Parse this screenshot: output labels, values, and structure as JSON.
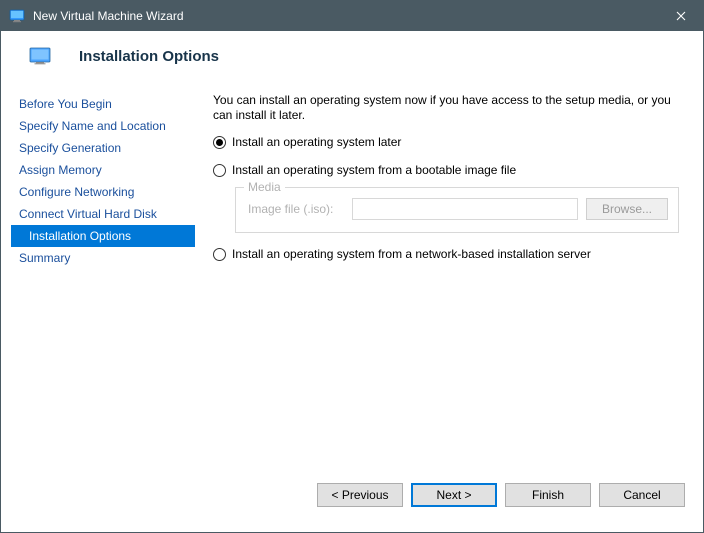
{
  "window": {
    "title": "New Virtual Machine Wizard"
  },
  "header": {
    "page_title": "Installation Options"
  },
  "sidebar": {
    "items": [
      {
        "label": "Before You Begin"
      },
      {
        "label": "Specify Name and Location"
      },
      {
        "label": "Specify Generation"
      },
      {
        "label": "Assign Memory"
      },
      {
        "label": "Configure Networking"
      },
      {
        "label": "Connect Virtual Hard Disk"
      },
      {
        "label": "Installation Options"
      },
      {
        "label": "Summary"
      }
    ],
    "selected_index": 6
  },
  "content": {
    "intro": "You can install an operating system now if you have access to the setup media, or you can install it later.",
    "options": {
      "later": "Install an operating system later",
      "bootable": "Install an operating system from a bootable image file",
      "network": "Install an operating system from a network-based installation server"
    },
    "selected_option": "later",
    "media": {
      "legend": "Media",
      "label": "Image file (.iso):",
      "value": "",
      "browse": "Browse..."
    }
  },
  "footer": {
    "previous": "< Previous",
    "next": "Next >",
    "finish": "Finish",
    "cancel": "Cancel"
  }
}
